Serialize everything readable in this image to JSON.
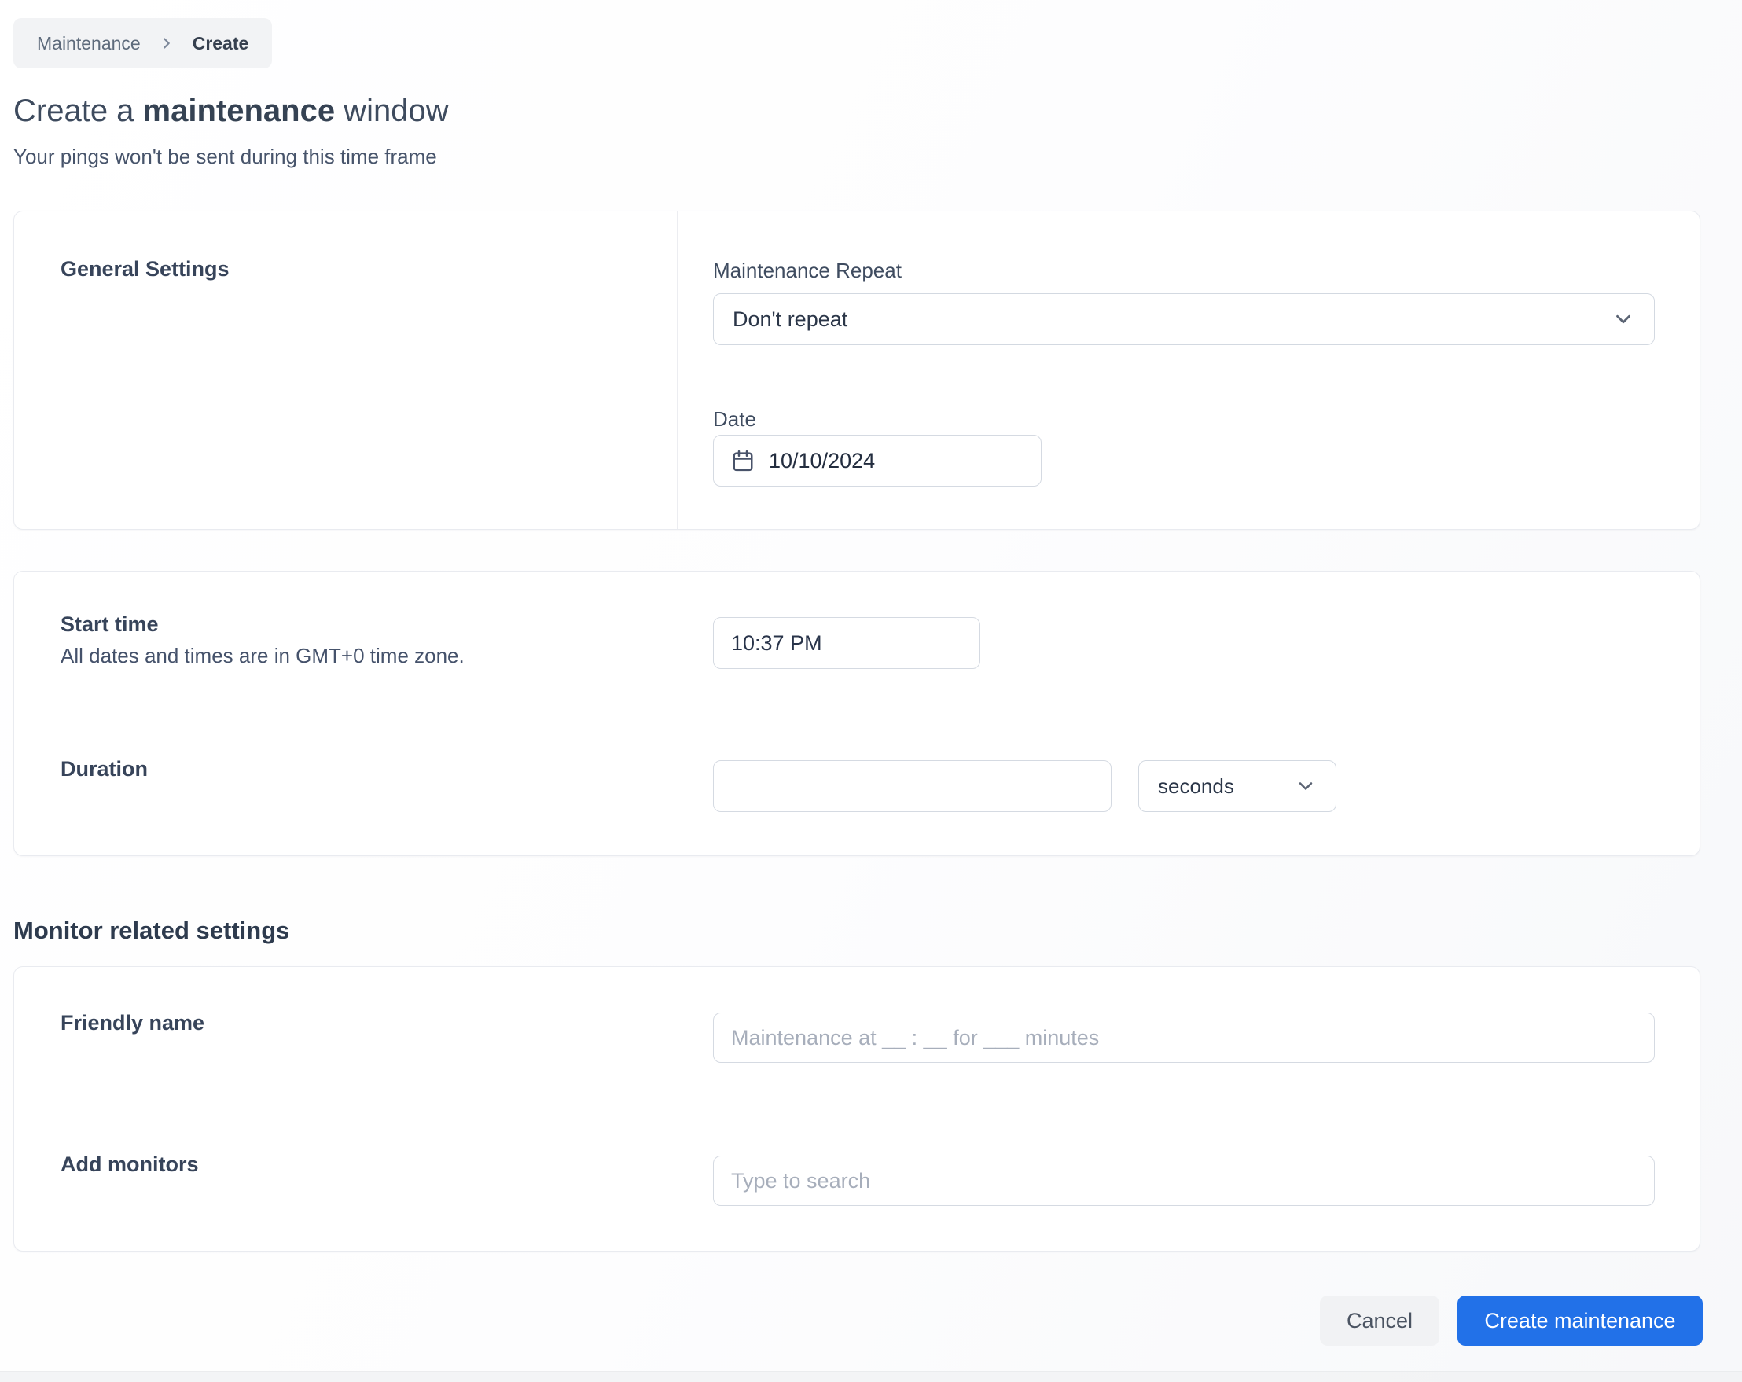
{
  "colors": {
    "accent": "#2271e8",
    "heading_text": "#3e4b5e",
    "input_border": "#d5dae2",
    "breadcrumb_bg": "#f2f3f5"
  },
  "breadcrumb": {
    "parent": "Maintenance",
    "current": "Create",
    "separator_icon": "chevron-right-icon"
  },
  "header": {
    "title_prefix": "Create a ",
    "title_emphasis": "maintenance",
    "title_suffix": " window",
    "subtitle": "Your pings won't be sent during this time frame"
  },
  "general_card": {
    "section_title": "General Settings",
    "repeat_label": "Maintenance Repeat",
    "repeat_value": "Don't repeat",
    "repeat_chevron_icon": "chevron-down-icon",
    "date_label": "Date",
    "date_value": "10/10/2024",
    "date_icon": "calendar-icon"
  },
  "time_card": {
    "start_label": "Start time",
    "start_hint": "All dates and times are in GMT+0 time zone.",
    "start_value": "10:37 PM",
    "duration_label": "Duration",
    "duration_value": "",
    "duration_unit": "seconds",
    "duration_chevron_icon": "chevron-down-icon"
  },
  "monitor_section": {
    "heading": "Monitor related settings",
    "friendly_label": "Friendly name",
    "friendly_value": "",
    "friendly_placeholder": "Maintenance at __ : __ for ___ minutes",
    "monitors_label": "Add monitors",
    "monitors_value": "",
    "monitors_placeholder": "Type to search"
  },
  "actions": {
    "cancel_label": "Cancel",
    "submit_label": "Create maintenance"
  }
}
